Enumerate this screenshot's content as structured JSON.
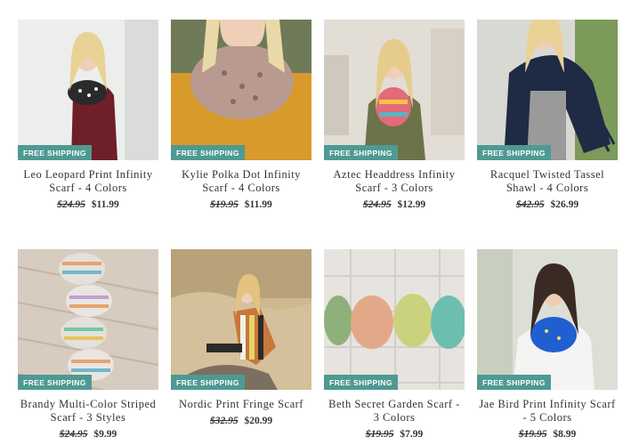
{
  "products": [
    {
      "badge": "FREE SHIPPING",
      "title": "Leo Leopard Print Infinity Scarf - 4 Colors",
      "old_price": "$24.95",
      "price": "$11.99"
    },
    {
      "badge": "FREE SHIPPING",
      "title": "Kylie Polka Dot Infinity Scarf - 4 Colors",
      "old_price": "$19.95",
      "price": "$11.99"
    },
    {
      "badge": "FREE SHIPPING",
      "title": "Aztec Headdress Infinity Scarf - 3 Colors",
      "old_price": "$24.95",
      "price": "$12.99"
    },
    {
      "badge": "FREE SHIPPING",
      "title": "Racquel Twisted Tassel Shawl - 4 Colors",
      "old_price": "$42.95",
      "price": "$26.99"
    },
    {
      "badge": "FREE SHIPPING",
      "title": "Brandy Multi-Color Striped Scarf - 3 Styles",
      "old_price": "$24.95",
      "price": "$9.99"
    },
    {
      "badge": "FREE SHIPPING",
      "title": "Nordic Print Fringe Scarf",
      "old_price": "$32.95",
      "price": "$20.99"
    },
    {
      "badge": "FREE SHIPPING",
      "title": "Beth Secret Garden Scarf - 3 Colors",
      "old_price": "$19.95",
      "price": "$7.99"
    },
    {
      "badge": "FREE SHIPPING",
      "title": "Jae Bird Print Infinity Scarf - 5 Colors",
      "old_price": "$19.95",
      "price": "$8.99"
    }
  ],
  "colors": {
    "badge": "#4e9a93",
    "text": "#333333",
    "background": "#ffffff"
  }
}
